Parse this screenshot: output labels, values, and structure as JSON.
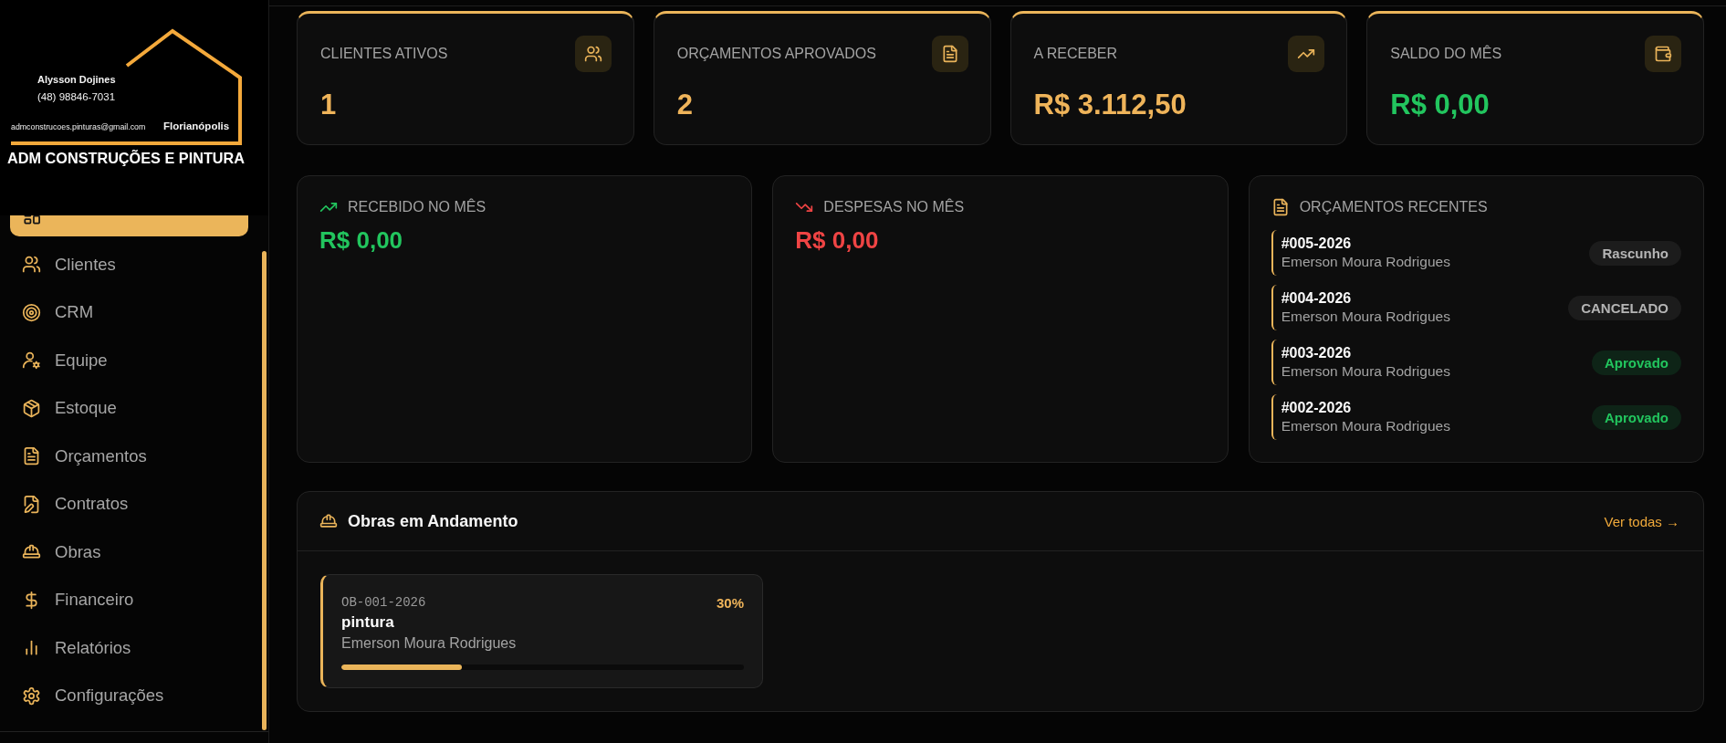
{
  "sidebar": {
    "logo": {
      "contact_name": "Alysson Dojines",
      "phone": "(48) 98846-7031",
      "email": "admconstrucoes.pinturas@gmail.com",
      "city": "Florianópolis",
      "company": "ADM CONSTRUÇÕES E PINTURA"
    },
    "items": [
      {
        "selected": true
      },
      {
        "label": "Clientes",
        "selected": false
      },
      {
        "label": "CRM",
        "selected": false
      },
      {
        "label": "Equipe",
        "selected": false
      },
      {
        "label": "Estoque",
        "selected": false
      },
      {
        "label": "Orçamentos",
        "selected": false
      },
      {
        "label": "Contratos",
        "selected": false
      },
      {
        "label": "Obras",
        "selected": false
      },
      {
        "label": "Financeiro",
        "selected": false
      },
      {
        "label": "Relatórios",
        "selected": false
      },
      {
        "label": "Configurações",
        "selected": false
      }
    ]
  },
  "stats": [
    {
      "label": "CLIENTES ATIVOS",
      "value": "1",
      "color": "#efb45a"
    },
    {
      "label": "ORÇAMENTOS APROVADOS",
      "value": "2",
      "color": "#efb45a"
    },
    {
      "label": "A RECEBER",
      "value": "R$ 3.112,50",
      "color": "#efb45a"
    },
    {
      "label": "SALDO DO MÊS",
      "value": "R$ 0,00",
      "color": "#22c55e"
    }
  ],
  "month_summary": [
    {
      "label": "RECEBIDO NO MÊS",
      "value": "R$ 0,00",
      "color": "#22c55e"
    },
    {
      "label": "DESPESAS NO MÊS",
      "value": "R$ 0,00",
      "color": "#ef4444"
    }
  ],
  "recent_budgets": {
    "title": "ORÇAMENTOS RECENTES",
    "items": [
      {
        "number": "#005-2026",
        "client": "Emerson Moura Rodrigues",
        "status": "Rascunho",
        "kind": "neutral"
      },
      {
        "number": "#004-2026",
        "client": "Emerson Moura Rodrigues",
        "status": "CANCELADO",
        "kind": "neutral"
      },
      {
        "number": "#003-2026",
        "client": "Emerson Moura Rodrigues",
        "status": "Aprovado",
        "kind": "success"
      },
      {
        "number": "#002-2026",
        "client": "Emerson Moura Rodrigues",
        "status": "Aprovado",
        "kind": "success"
      }
    ]
  },
  "works": {
    "title": "Obras em Andamento",
    "link": "Ver todas →",
    "items": [
      {
        "code": "OB-001-2026",
        "percent": "30%",
        "name": "pintura",
        "client": "Emerson Moura Rodrigues",
        "level": 0.3
      }
    ]
  }
}
